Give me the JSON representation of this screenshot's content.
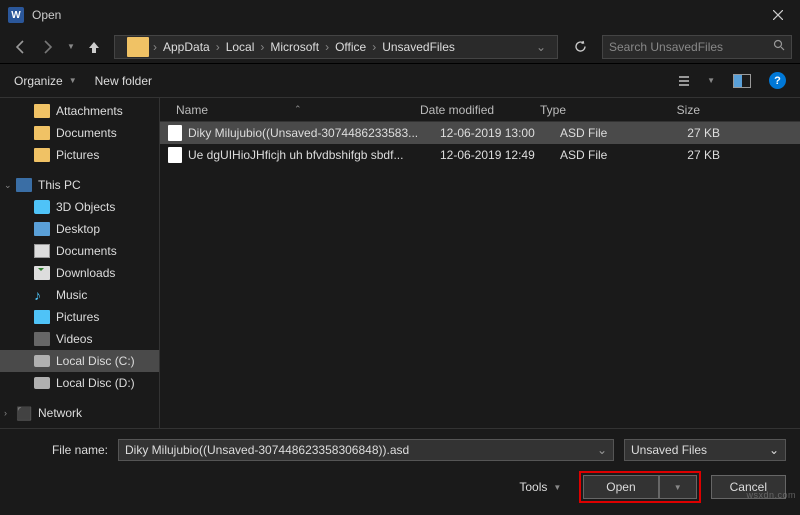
{
  "title": "Open",
  "breadcrumb": [
    "AppData",
    "Local",
    "Microsoft",
    "Office",
    "UnsavedFiles"
  ],
  "search_placeholder": "Search UnsavedFiles",
  "toolbar": {
    "organize": "Organize",
    "newfolder": "New folder"
  },
  "sidebar": {
    "quick": [
      "Attachments",
      "Documents",
      "Pictures"
    ],
    "thispc_label": "This PC",
    "thispc": [
      "3D Objects",
      "Desktop",
      "Documents",
      "Downloads",
      "Music",
      "Pictures",
      "Videos",
      "Local Disc (C:)",
      "Local Disc (D:)"
    ],
    "network": "Network"
  },
  "columns": {
    "name": "Name",
    "date": "Date modified",
    "type": "Type",
    "size": "Size"
  },
  "files": [
    {
      "name": "Diky Milujubio((Unsaved-3074486233583...",
      "date": "12-06-2019 13:00",
      "type": "ASD File",
      "size": "27 KB",
      "selected": true
    },
    {
      "name": "Ue dgUIHioJHficjh uh bfvdbshifgb sbdf...",
      "date": "12-06-2019 12:49",
      "type": "ASD File",
      "size": "27 KB",
      "selected": false
    }
  ],
  "filename_label": "File name:",
  "filename_value": "Diky Milujubio((Unsaved-307448623358306848)).asd",
  "filter_value": "Unsaved Files",
  "tools_label": "Tools",
  "open_label": "Open",
  "cancel_label": "Cancel",
  "watermark": "wsxdn.com"
}
